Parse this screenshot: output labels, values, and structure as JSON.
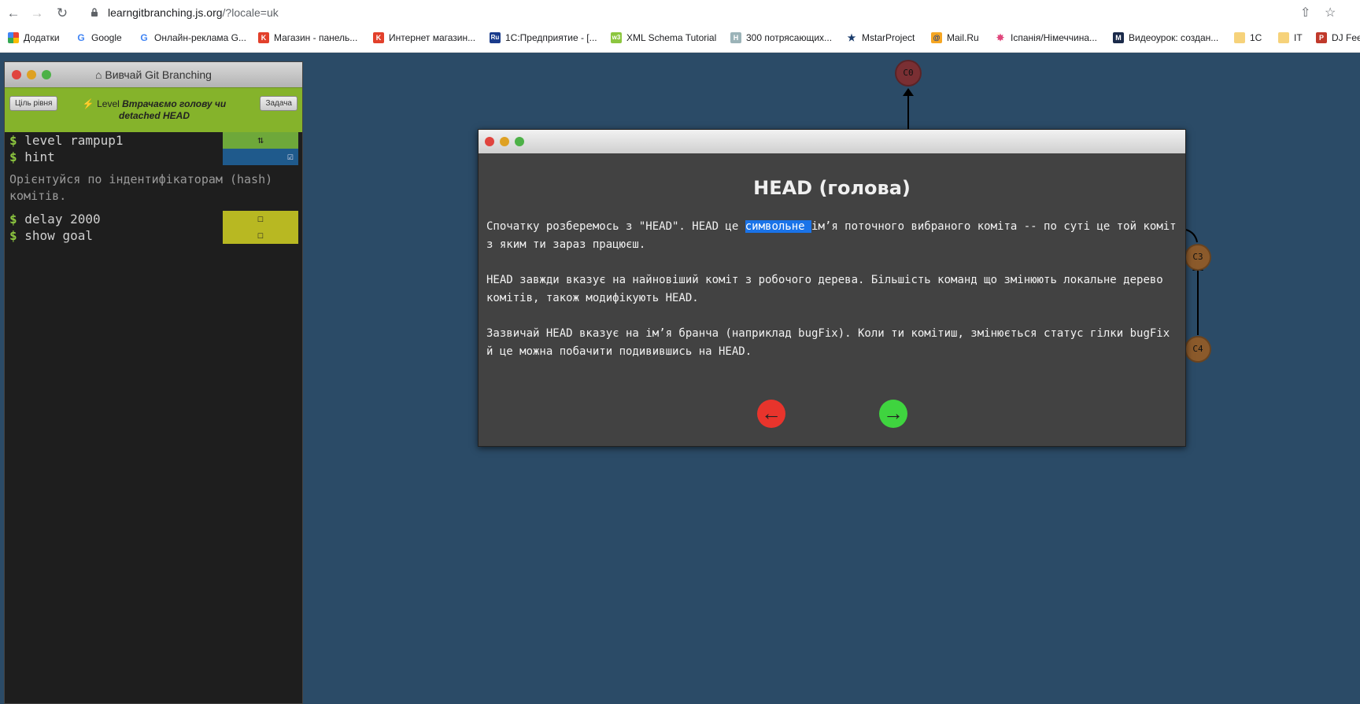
{
  "browser": {
    "url_host": "learngitbranching.js.org",
    "url_path": "/?locale=uk",
    "bookmarks": [
      {
        "label": "Додатки",
        "icon": "apps-grid-icon"
      },
      {
        "label": "Google",
        "icon": "google-icon"
      },
      {
        "label": "Онлайн-реклама G...",
        "icon": "google-icon"
      },
      {
        "label": "Магазин - панель...",
        "icon": "k-icon"
      },
      {
        "label": "Интернет магазин...",
        "icon": "k-icon"
      },
      {
        "label": "1С:Предприятие - [...",
        "icon": "ru-icon"
      },
      {
        "label": "XML Schema Tutorial",
        "icon": "w3-icon"
      },
      {
        "label": "300 потрясающих...",
        "icon": "h-icon"
      },
      {
        "label": "MstarProject",
        "icon": "mstar-icon"
      },
      {
        "label": "Mail.Ru",
        "icon": "at-icon"
      },
      {
        "label": "Іспанія/Німеччина...",
        "icon": "star-icon"
      },
      {
        "label": "Видеоурок: создан...",
        "icon": "m-icon"
      },
      {
        "label": "1С",
        "icon": "folder-icon"
      },
      {
        "label": "IT",
        "icon": "folder-icon"
      },
      {
        "label": "DJ Fee",
        "icon": "p-icon"
      }
    ]
  },
  "panel": {
    "title": "Вивчай Git Branching",
    "goal_button": "Ціль рівня",
    "task_button": "Задача",
    "level_prefix": "Level",
    "level_name": "Втрачаємо голову чи detached HEAD",
    "commands": [
      {
        "text": "level rampup1",
        "status_icon": "refresh-icon",
        "status_color": "#6ea83a"
      },
      {
        "text": "hint",
        "status_icon": "checked-icon",
        "status_color": "#1f5a8c"
      }
    ],
    "hint_output": "Орієнтуйся по індентифікаторам (hash) комітів.",
    "pending": [
      {
        "text": "delay 2000",
        "status_icon": "checkbox-icon",
        "status_color": "#b8b822"
      },
      {
        "text": "show goal",
        "status_icon": "checkbox-icon",
        "status_color": "#b8b822"
      }
    ]
  },
  "graph": {
    "nodes": [
      "C0",
      "C3",
      "C4"
    ]
  },
  "modal": {
    "heading": "HEAD (голова)",
    "p1_a": "Спочатку розберемось з \"HEAD\". HEAD це ",
    "p1_hl": "символьне ",
    "p1_b": "ім’я поточного вибраного коміта -- по суті це той коміт з яким ти зараз працюєш.",
    "p2": "HEAD завжди вказує на найновіший коміт з робочого дерева. Більшість команд що змінюють локальне дерево комітів, також модифікують HEAD.",
    "p3": "Зазвичай HEAD вказує на ім’я бранча (наприклад bugFix). Коли ти комітиш, змінюється статус гілки bugFix й це можна побачити подивившись на HEAD.",
    "prev_icon": "arrow-left-icon",
    "next_icon": "arrow-right-icon"
  }
}
